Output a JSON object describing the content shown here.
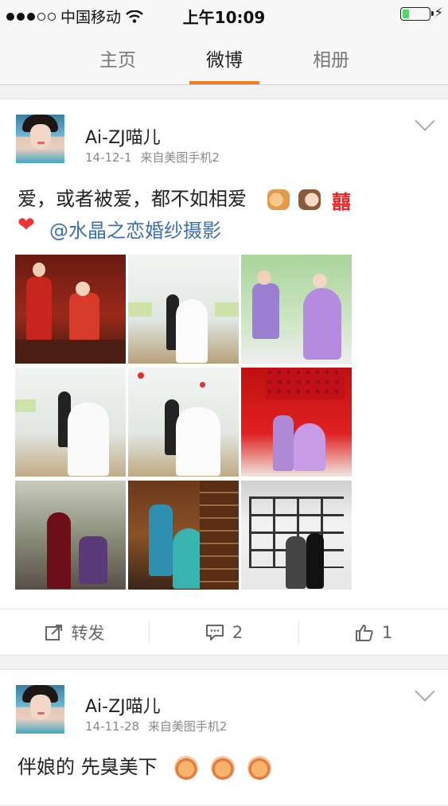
{
  "status_bar": {
    "carrier": "中国移动",
    "time": "上午10:09",
    "battery_level": 0.25,
    "signal_bars_filled": 3,
    "signal_bars_total": 5
  },
  "tabs": [
    {
      "label": "主页",
      "active": false
    },
    {
      "label": "微博",
      "active": true
    },
    {
      "label": "相册",
      "active": false
    }
  ],
  "posts": [
    {
      "username": "Ai-ZJ喵儿",
      "date": "14-12-1",
      "source": "来自美图手机2",
      "text": "爱，或者被爱，都不如相爱",
      "xi_glyph": "囍",
      "mention": "@水晶之恋婚纱摄影",
      "photo_count": 9,
      "actions": {
        "repost_label": "转发",
        "comment_count": "2",
        "like_count": "1"
      }
    },
    {
      "username": "Ai-ZJ喵儿",
      "date": "14-11-28",
      "source": "来自美图手机2",
      "text": "伴娘的 先臭美下"
    }
  ],
  "icons": {
    "wifi": "wifi-icon",
    "battery": "battery-icon",
    "charging": "bolt-icon",
    "expand": "chevron-down-icon",
    "repost": "repost-icon",
    "comment": "comment-icon",
    "like": "thumbs-up-icon"
  },
  "colors": {
    "accent": "#f07b22",
    "mention": "#3b6eb8",
    "battery": "#4cd964"
  }
}
